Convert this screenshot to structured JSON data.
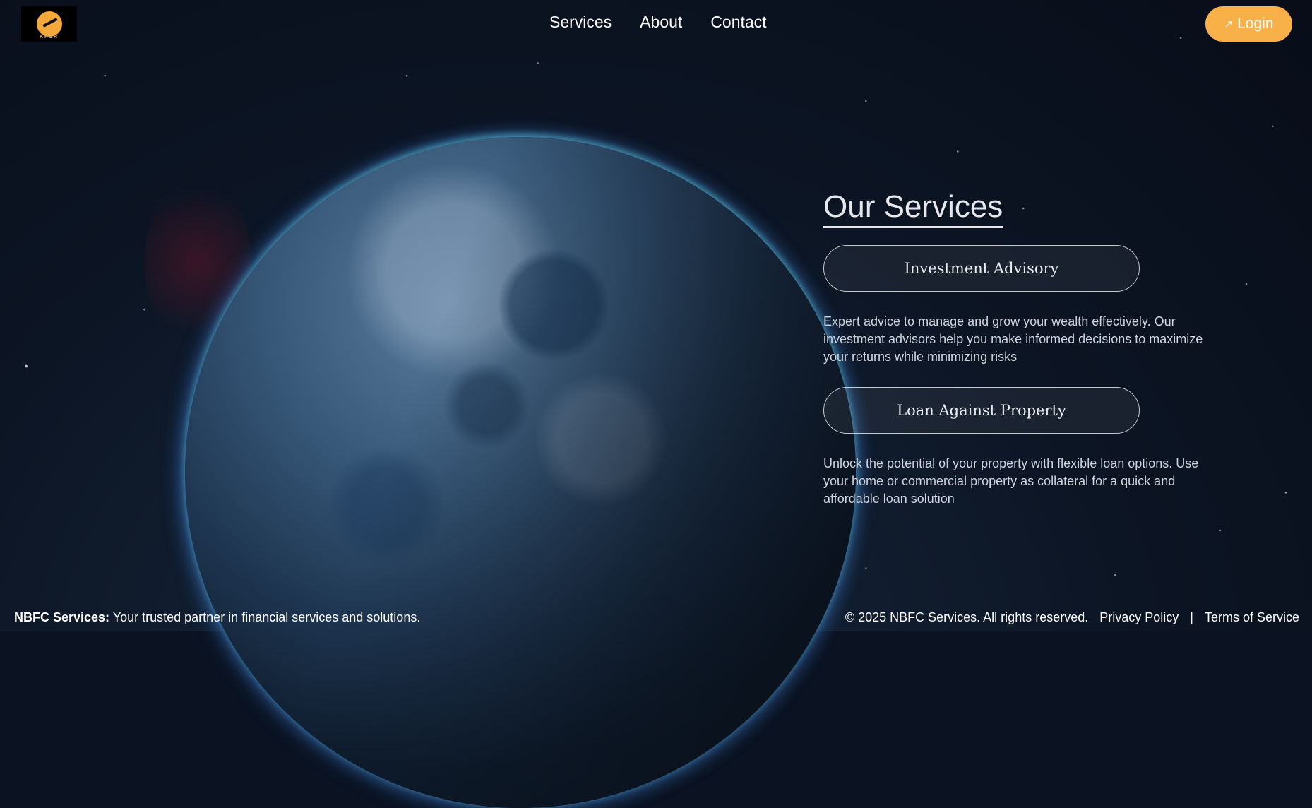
{
  "brand": {
    "logo_text": "KPLR"
  },
  "nav": {
    "services": "Services",
    "about": "About",
    "contact": "Contact"
  },
  "login": {
    "icon": "arrow-up-right-icon",
    "label": "Login"
  },
  "services": {
    "heading": "Our Services",
    "items": [
      {
        "title": "Investment Advisory",
        "description": "Expert advice to manage and grow your wealth effectively. Our investment advisors help you make informed decisions to maximize your returns while minimizing risks"
      },
      {
        "title": "Loan Against Property",
        "description": "Unlock the potential of your property with flexible loan options. Use your home or commercial property as collateral for a quick and affordable loan solution"
      }
    ]
  },
  "footer": {
    "brand_label": "NBFC Services:",
    "tagline": "Your trusted partner in financial services and solutions.",
    "copyright": "© 2025 NBFC Services. All rights reserved.",
    "privacy": "Privacy Policy",
    "separator": "|",
    "terms": "Terms of Service"
  },
  "colors": {
    "accent": "#f8b049",
    "background": "#0b1322"
  }
}
